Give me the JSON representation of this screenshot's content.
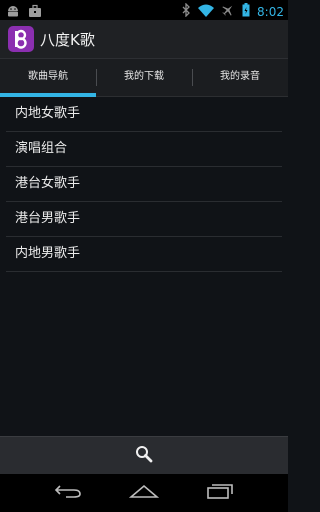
{
  "status_bar": {
    "time": "8:02",
    "icons": [
      "android-icon",
      "briefcase-icon",
      "bluetooth-icon",
      "wifi-icon",
      "airplane-icon",
      "battery-icon"
    ]
  },
  "app": {
    "title": "八度K歌",
    "icon": "app-logo-icon",
    "brand_color": "#8b2fb0"
  },
  "tabs": [
    {
      "label": "歌曲导航",
      "active": true
    },
    {
      "label": "我的下载",
      "active": false
    },
    {
      "label": "我的录音",
      "active": false
    }
  ],
  "list": [
    {
      "label": "内地女歌手"
    },
    {
      "label": "演唱组合"
    },
    {
      "label": "港台女歌手"
    },
    {
      "label": "港台男歌手"
    },
    {
      "label": "内地男歌手"
    }
  ],
  "bottom_bar": {
    "icon": "search-icon"
  },
  "navbar": {
    "icons": [
      "back-icon",
      "home-icon",
      "recent-apps-icon"
    ]
  },
  "colors": {
    "accent": "#33b5e5",
    "background": "#101317"
  }
}
